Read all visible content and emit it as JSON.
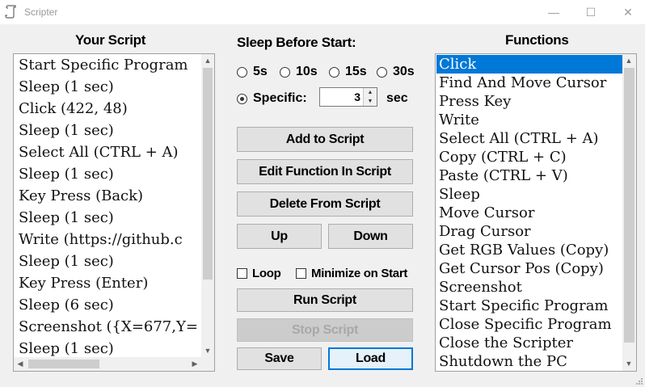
{
  "window": {
    "title": "Scripter",
    "minimize": "—",
    "maximize": "☐",
    "close": "✕"
  },
  "headings": {
    "script": "Your Script",
    "sleep": "Sleep Before Start:",
    "functions": "Functions"
  },
  "script_items": [
    "Start Specific Program",
    "Sleep (1 sec)",
    "Click (422, 48)",
    "Sleep (1 sec)",
    "Select All (CTRL + A)",
    "Sleep (1 sec)",
    "Key Press (Back)",
    "Sleep (1 sec)",
    "Write (https://github.c",
    "Sleep (1 sec)",
    "Key Press (Enter)",
    "Sleep (6 sec)",
    "Screenshot ({X=677,Y=",
    "Sleep (1 sec)"
  ],
  "sleep": {
    "options": [
      "5s",
      "10s",
      "15s",
      "30s"
    ],
    "specific_label": "Specific:",
    "specific_value": "3",
    "unit": "sec",
    "selected": "specific"
  },
  "buttons": {
    "add": "Add to Script",
    "edit": "Edit Function In Script",
    "delete": "Delete From Script",
    "up": "Up",
    "down": "Down",
    "run": "Run Script",
    "stop": "Stop Script",
    "save": "Save",
    "load": "Load"
  },
  "checks": {
    "loop": "Loop",
    "minimize": "Minimize on Start"
  },
  "functions": [
    "Click",
    "Find And Move Cursor",
    "Press Key",
    "Write",
    "Select All (CTRL + A)",
    "Copy (CTRL + C)",
    "Paste (CTRL + V)",
    "Sleep",
    "Move Cursor",
    "Drag Cursor",
    "Get RGB Values (Copy)",
    "Get Cursor Pos (Copy)",
    "Screenshot",
    "Start Specific Program",
    "Close Specific Program",
    "Close the Scripter",
    "Shutdown the PC"
  ],
  "selected_function": "Click",
  "colors": {
    "selection": "#0078d7",
    "focus_border": "#0078d7"
  }
}
